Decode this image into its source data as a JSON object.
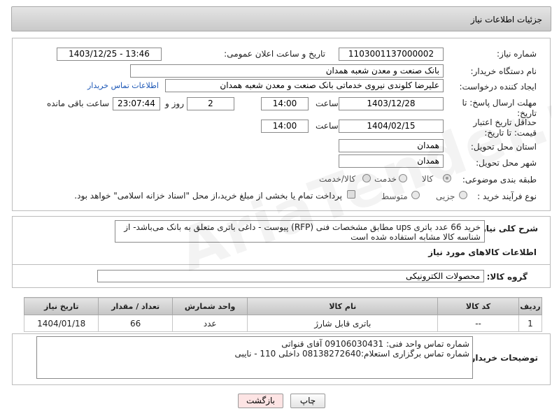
{
  "header": {
    "title": "جزئیات اطلاعات نیاز"
  },
  "fields": {
    "need_number_label": "شماره نیاز:",
    "need_number": "1103001137000002",
    "announce_label": "تاریخ و ساعت اعلان عمومی:",
    "announce_value": "1403/12/25 - 13:46",
    "buyer_org_label": "نام دستگاه خریدار:",
    "buyer_org": "بانک صنعت و معدن شعبه همدان",
    "requester_label": "ایجاد کننده درخواست:",
    "requester": "علیرضا  کلوندی نیروی خدماتی  بانک صنعت و معدن شعبه همدان",
    "contact_link": "اطلاعات تماس خریدار",
    "deadline_label": "مهلت ارسال پاسخ: تا تاریخ:",
    "deadline_date": "1403/12/28",
    "time_label": "ساعت",
    "deadline_time": "14:00",
    "days_value": "2",
    "days_label": "روز و",
    "remain_time": "23:07:44",
    "remain_label": "ساعت باقی مانده",
    "validity_label": "حداقل تاریخ اعتبار قیمت: تا تاریخ:",
    "validity_date": "1404/02/15",
    "validity_time": "14:00",
    "province_label": "استان محل تحویل:",
    "province": "همدان",
    "city_label": "شهر محل تحویل:",
    "city": "همدان",
    "category_label": "طبقه بندی موضوعی:",
    "cat_goods": "کالا",
    "cat_service": "خدمت",
    "cat_goods_service": "کالا/خدمت",
    "process_label": "نوع فرآیند خرید :",
    "proc_partial": "جزیی",
    "proc_medium": "متوسط",
    "payment_note": "پرداخت تمام یا بخشی از مبلغ خرید،از محل \"اسناد خزانه اسلامی\" خواهد بود."
  },
  "description": {
    "label": "شرح کلی نیاز:",
    "text": "خرید 66 عدد باتری ups مطابق مشخصات فنی (RFP) پیوست - داغی باتری متعلق به بانک می‌باشد- از شناسه کالا مشابه استفاده شده است"
  },
  "goods_info_title": "اطلاعات کالاهای مورد نیاز",
  "group": {
    "label": "گروه کالا:",
    "value": "محصولات الکترونیکی"
  },
  "table": {
    "headers": [
      "ردیف",
      "کد کالا",
      "نام کالا",
      "واحد شمارش",
      "تعداد / مقدار",
      "تاریخ نیاز"
    ],
    "rows": [
      [
        "1",
        "--",
        "باتری قابل شارژ",
        "عدد",
        "66",
        "1404/01/18"
      ]
    ]
  },
  "buyer_notes": {
    "label": "توضیحات خریدار:",
    "line1": "شماره تماس واحد فنی: 09106030431 آقای قنواتی",
    "line2": "شماره تماس برگزاری استعلام:08138272640 داخلی 110 - نایبی"
  },
  "buttons": {
    "print": "چاپ",
    "back": "بازگشت"
  },
  "watermark": "AriaTender.neT",
  "colors": {
    "link": "#1a55b5",
    "back_button_bg": "#fde4e4"
  }
}
